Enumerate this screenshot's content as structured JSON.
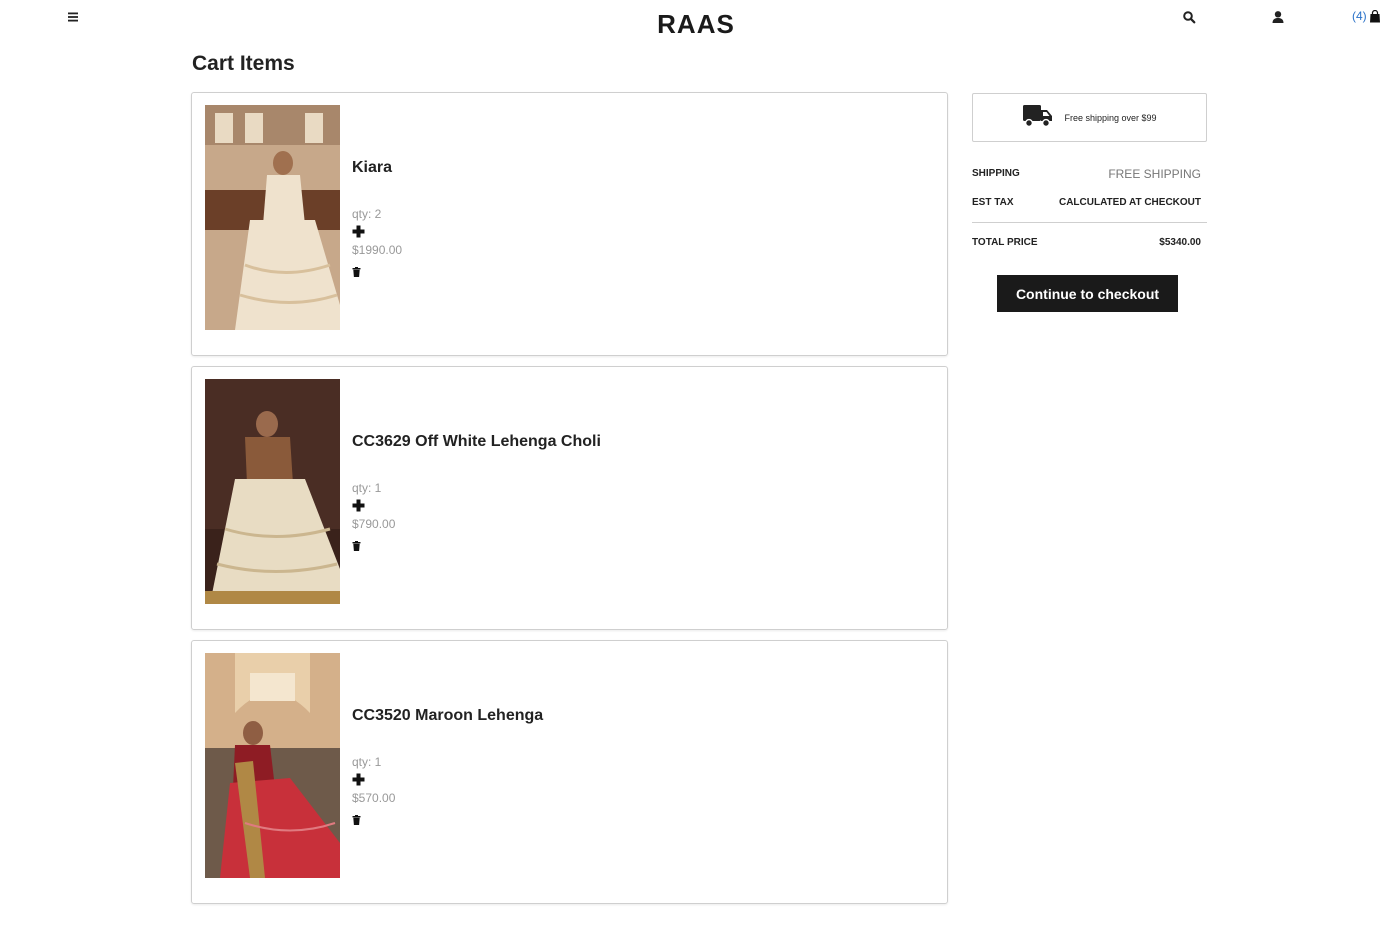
{
  "header": {
    "brand": "RAAS",
    "cart_count": "(4)"
  },
  "page_title": "Cart Items",
  "items": [
    {
      "name": "Kiara",
      "qty": "qty: 2",
      "price": "$1990.00",
      "image_palette": [
        "#b99476",
        "#efe2cd",
        "#6b3f28"
      ]
    },
    {
      "name": "CC3629 Off White Lehenga Choli",
      "qty": "qty: 1",
      "price": "$790.00",
      "image_palette": [
        "#4a2d24",
        "#e8dcc3",
        "#8a5a3a"
      ]
    },
    {
      "name": "CC3520 Maroon Lehenga",
      "qty": "qty: 1",
      "price": "$570.00",
      "image_palette": [
        "#c9a27a",
        "#c8303a",
        "#6e1a1f"
      ]
    }
  ],
  "summary": {
    "banner_text": "Free shipping over $99",
    "shipping_label": "SHIPPING",
    "shipping_value": "FREE SHIPPING",
    "tax_label": "EST TAX",
    "tax_value": "CALCULATED AT CHECKOUT",
    "total_label": "TOTAL PRICE",
    "total_value": "$5340.00",
    "checkout_label": "Continue to checkout"
  },
  "icons": [
    "menu-icon",
    "search-icon",
    "user-icon",
    "shopping-bag-icon",
    "plus-icon",
    "trash-icon",
    "truck-icon"
  ],
  "colors": {
    "accent": "#2a72c9",
    "button_bg": "#1a1a1a"
  }
}
